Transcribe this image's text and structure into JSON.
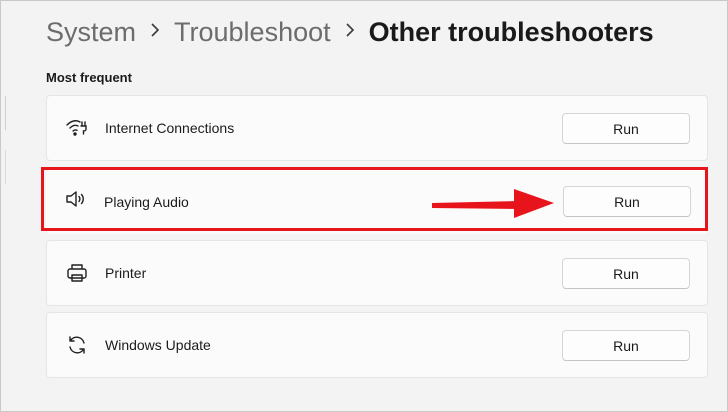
{
  "breadcrumb": {
    "items": [
      "System",
      "Troubleshoot",
      "Other troubleshooters"
    ]
  },
  "section": {
    "title": "Most frequent"
  },
  "troubleshooters": [
    {
      "label": "Internet Connections",
      "icon": "wifi-icon",
      "button": "Run"
    },
    {
      "label": "Playing Audio",
      "icon": "speaker-icon",
      "button": "Run"
    },
    {
      "label": "Printer",
      "icon": "printer-icon",
      "button": "Run"
    },
    {
      "label": "Windows Update",
      "icon": "sync-icon",
      "button": "Run"
    }
  ],
  "colors": {
    "annotation": "#e8141b",
    "background": "#f3f3f3",
    "card": "#fbfbfb"
  }
}
